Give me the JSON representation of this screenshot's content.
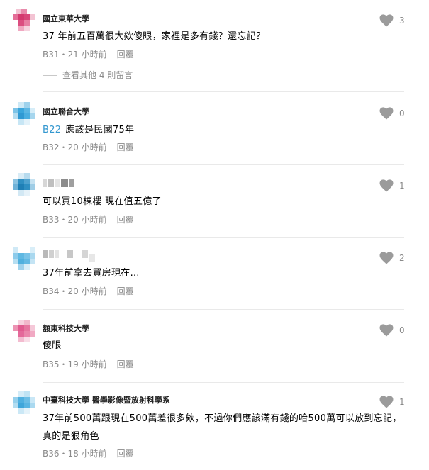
{
  "comments": [
    {
      "name": "國立東華大學",
      "text": "37 年前五百萬很大欸傻眼，家裡是多有錢？還忘記？",
      "floor": "B31",
      "sep": "・",
      "time": "21 小時前",
      "reply_label": "回覆",
      "likes": "3",
      "avatar_color": "#d9477a",
      "more_replies": "查看其他 4 則留言"
    },
    {
      "name": "國立聯合大學",
      "mention": "B22",
      "text": "應該是民國75年",
      "floor": "B32",
      "sep": "・",
      "time": "20 小時前",
      "reply_label": "回覆",
      "likes": "0",
      "avatar_color": "#3aa6dc"
    },
    {
      "name": "",
      "text": "可以買10棟樓 現在值五億了",
      "floor": "B33",
      "sep": "・",
      "time": "20 小時前",
      "reply_label": "回覆",
      "likes": "1",
      "avatar_color": "#2f8fc2"
    },
    {
      "name": "",
      "text": "37年前拿去買房現在…",
      "floor": "B34",
      "sep": "・",
      "time": "20 小時前",
      "reply_label": "回覆",
      "likes": "2",
      "avatar_color": "#5fb8e2"
    },
    {
      "name": "額東科技大學",
      "text": "傻眼",
      "floor": "B35",
      "sep": "・",
      "time": "19 小時前",
      "reply_label": "回覆",
      "likes": "0",
      "avatar_color": "#e05b8f"
    },
    {
      "name": "中臺科技大學 醫學影像暨放射科學系",
      "text": "37年前500萬跟現在500萬差很多欸，不過你們應該滿有錢的哈500萬可以放到忘記，真的是狠角色",
      "floor": "B36",
      "sep": "・",
      "time": "18 小時前",
      "reply_label": "回覆",
      "likes": "1",
      "avatar_color": "#4fb0e0"
    }
  ],
  "colors": {
    "meta_gray": "#8a8a8a",
    "heart_gray": "#9b9b9b",
    "mention_blue": "#3397cf",
    "divider": "#e9e9e9"
  },
  "icons": {
    "like": "heart-icon"
  }
}
